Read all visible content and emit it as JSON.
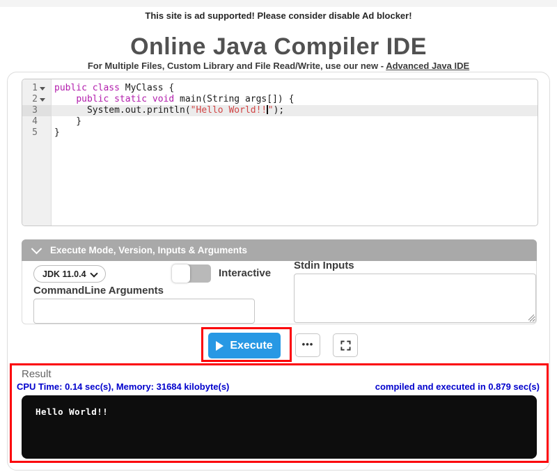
{
  "colors": {
    "execute_blue": "#2798e4",
    "annotation_red": "#fb0007",
    "info_navy": "#0000cc",
    "keyword_magenta": "#b21dac",
    "string_red": "#d14545",
    "panel_bar_gray": "#a9a9a9",
    "terminal_black": "#0d0d0d"
  },
  "ad_banner": {
    "text": "This site is ad supported! Please consider disable Ad blocker!"
  },
  "header": {
    "title": "Online Java Compiler IDE",
    "subtitle": "For Multiple Files, Custom Library and File Read/Write, use our new -",
    "subtitle_link": "Advanced Java IDE"
  },
  "editor": {
    "lines": [
      {
        "n": "1",
        "fold": true,
        "active": false,
        "code": [
          {
            "t": "public class ",
            "c": "k"
          },
          {
            "t": "MyClass {",
            "c": "p"
          }
        ]
      },
      {
        "n": "2",
        "fold": true,
        "active": false,
        "code": [
          {
            "t": "    ",
            "c": "p"
          },
          {
            "t": "public static void ",
            "c": "k"
          },
          {
            "t": "main(String args[]) {",
            "c": "p"
          }
        ]
      },
      {
        "n": "3",
        "fold": false,
        "active": true,
        "code": [
          {
            "t": "      System.out.println(",
            "c": "p"
          },
          {
            "t": "\"Hello World!!",
            "c": "s"
          },
          {
            "caret": true
          },
          {
            "t": "\"",
            "c": "s"
          },
          {
            "t": ");",
            "c": "p"
          }
        ]
      },
      {
        "n": "4",
        "fold": false,
        "active": false,
        "code": [
          {
            "t": "    }",
            "c": "p"
          }
        ]
      },
      {
        "n": "5",
        "fold": false,
        "active": false,
        "code": [
          {
            "t": "}",
            "c": "p"
          }
        ]
      }
    ]
  },
  "options": {
    "header": "Execute Mode, Version, Inputs & Arguments",
    "jdk_version": "JDK 11.0.4",
    "interactive_label": "Interactive",
    "stdin_label": "Stdin Inputs",
    "stdin_value": "",
    "cmdline_label": "CommandLine Arguments",
    "cmdline_value": ""
  },
  "actions": {
    "execute_label": "Execute",
    "more_icon": "•••"
  },
  "result": {
    "title": "Result",
    "stats_left": "CPU Time: 0.14 sec(s), Memory: 31684 kilobyte(s)",
    "stats_right": "compiled and executed in 0.879 sec(s)",
    "output": "Hello World!!"
  }
}
